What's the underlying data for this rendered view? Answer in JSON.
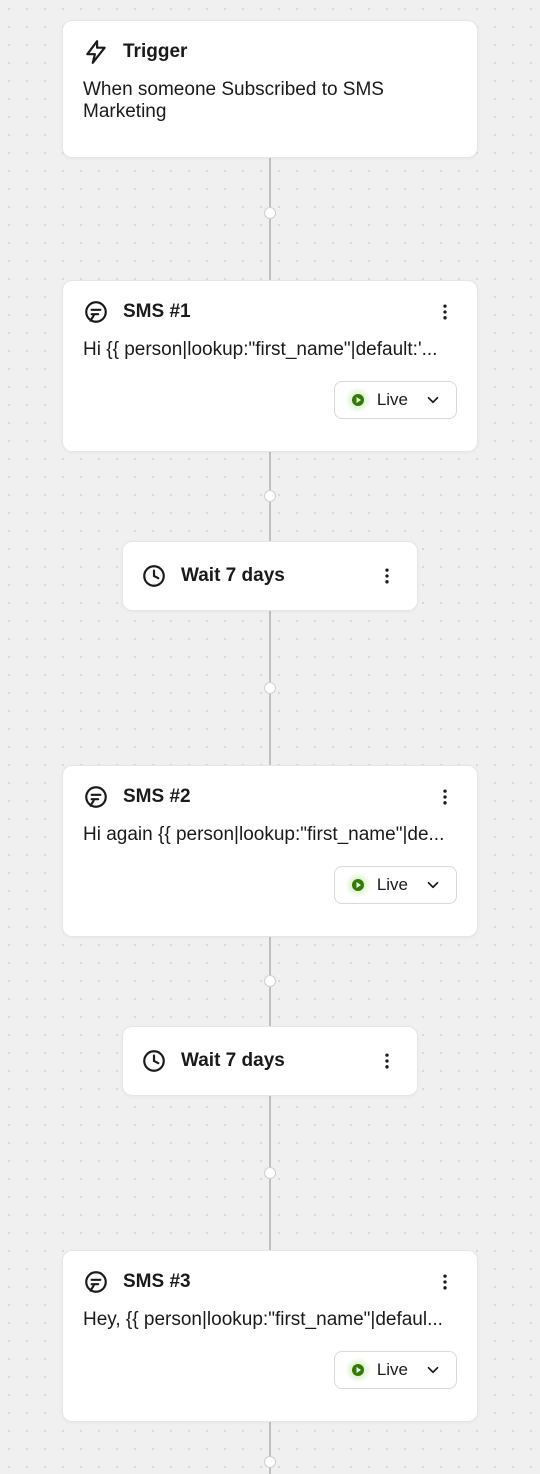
{
  "flow": {
    "trigger": {
      "title": "Trigger",
      "description": "When someone Subscribed to SMS Marketing"
    },
    "nodes": [
      {
        "kind": "sms",
        "title": "SMS #1",
        "body": "Hi {{ person|lookup:\"first_name\"|default:'...",
        "status": "Live"
      },
      {
        "kind": "wait",
        "title": "Wait 7 days"
      },
      {
        "kind": "sms",
        "title": "SMS #2",
        "body": "Hi again {{ person|lookup:\"first_name\"|de...",
        "status": "Live"
      },
      {
        "kind": "wait",
        "title": "Wait 7 days"
      },
      {
        "kind": "sms",
        "title": "SMS #3",
        "body": "Hey, {{ person|lookup:\"first_name\"|defaul...",
        "status": "Live"
      }
    ]
  },
  "icons": {
    "trigger": "bolt-icon",
    "sms": "sms-bubble-icon",
    "wait": "clock-icon",
    "more": "more-vertical-icon",
    "live": "play-circle-icon",
    "chevron": "chevron-down-icon"
  },
  "colors": {
    "liveGreen": "#2e7d00",
    "border": "#e5e5e5",
    "text": "#1a1a1a",
    "canvasBg": "#f0f0f0",
    "dotGrid": "#cfcfcf"
  }
}
